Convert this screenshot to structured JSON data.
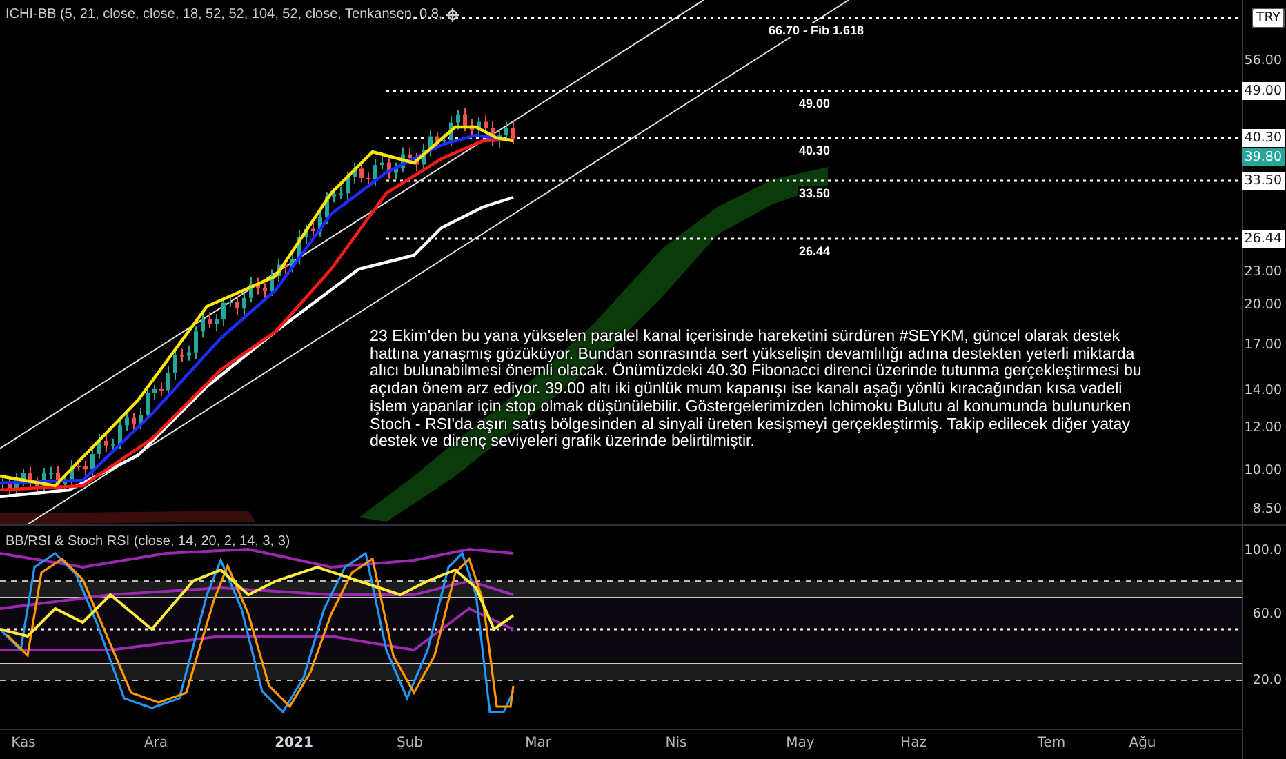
{
  "main_pane": {
    "indicator_label": "ICHI-BB (5, 21, close, close, 18, 52, 52, 104, 52, close, Tenkansen, 0.8,",
    "levels": [
      {
        "label": "66.70 - Fib 1.618"
      },
      {
        "label": "49.00"
      },
      {
        "label": "40.30"
      },
      {
        "label": "33.50"
      },
      {
        "label": "26.44"
      }
    ],
    "annotation": "23 Ekim'den bu yana yükselen paralel kanal içerisinde hareketini sürdüren #SEYKM, güncel olarak destek hattına yanaşmış gözüküyor. Bundan sonrasında sert yükselişin devamlılığı adına destekten yeterli miktarda alıcı bulunabilmesi önemli olacak. Önümüzdeki 40.30 Fibonacci direnci üzerinde tutunma gerçekleştirmesi bu açıdan önem arz ediyor. 39.00 altı iki günlük mum kapanışı ise kanalı aşağı yönlü kıracağından kısa vadeli işlem yapanlar için stop olmak düşünülebilir. Göstergelerimizden Ichimoku Bulutu al konumunda bulunurken Stoch - RSI'da aşırı satış bölgesinden al sinyali üreten kesişmeyi gerçekleştirmiş. Takip edilecek diğer yatay destek ve direnç seviyeleri grafik üzerinde belirtilmiştir."
  },
  "price_axis": {
    "labels": [
      {
        "text": "TRY",
        "kind": "currency"
      },
      {
        "text": "56.00",
        "kind": "tick"
      },
      {
        "text": "49.00",
        "kind": "level"
      },
      {
        "text": "40.30",
        "kind": "level"
      },
      {
        "text": "39.80",
        "kind": "last"
      },
      {
        "text": "33.50",
        "kind": "level"
      },
      {
        "text": "26.44",
        "kind": "level"
      },
      {
        "text": "23.00",
        "kind": "tick"
      },
      {
        "text": "20.00",
        "kind": "tick"
      },
      {
        "text": "17.00",
        "kind": "tick"
      },
      {
        "text": "14.00",
        "kind": "tick"
      },
      {
        "text": "12.00",
        "kind": "tick"
      },
      {
        "text": "10.00",
        "kind": "tick"
      },
      {
        "text": "8.50",
        "kind": "tick"
      }
    ]
  },
  "oscillator_pane": {
    "indicator_label": "BB/RSI & Stoch RSI (close, 14, 20, 2, 14, 3, 3)",
    "axis_labels": [
      "100.0",
      "60.0",
      "20.0"
    ]
  },
  "time_axis": {
    "labels": [
      {
        "text": "Kas",
        "bold": false
      },
      {
        "text": "Ara",
        "bold": false
      },
      {
        "text": "2021",
        "bold": true
      },
      {
        "text": "Şub",
        "bold": false
      },
      {
        "text": "Mar",
        "bold": false
      },
      {
        "text": "Nis",
        "bold": false
      },
      {
        "text": "May",
        "bold": false
      },
      {
        "text": "Haz",
        "bold": false
      },
      {
        "text": "Tem",
        "bold": false
      },
      {
        "text": "Ağu",
        "bold": false
      }
    ]
  }
}
